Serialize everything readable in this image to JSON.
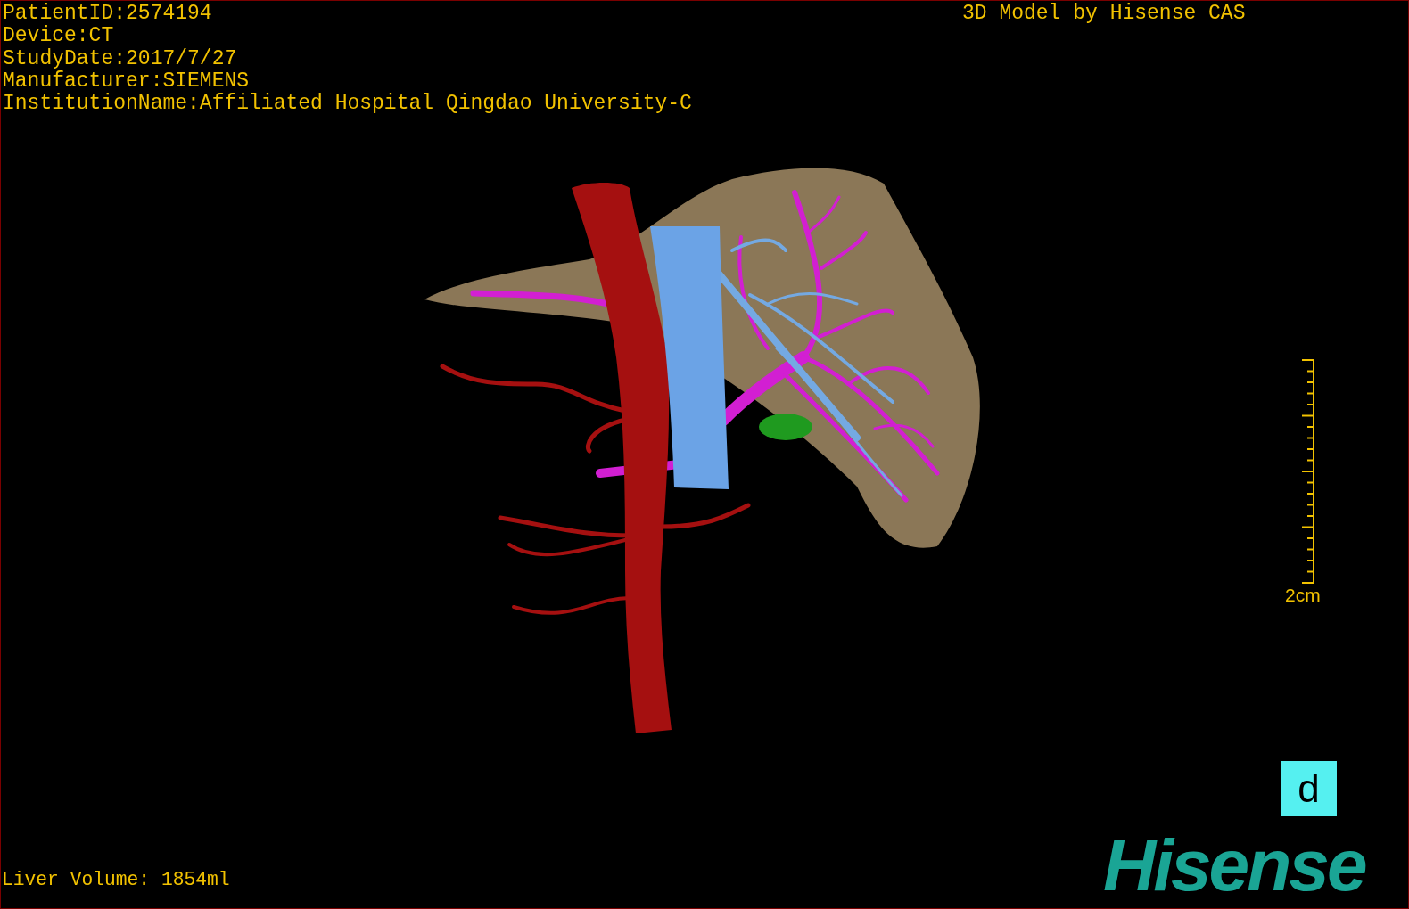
{
  "patient_info": [
    "PatientID:2574194",
    "Device:CT",
    "StudyDate:2017/7/27",
    "Manufacturer:SIEMENS",
    "InstitutionName:Affiliated Hospital Qingdao University-C"
  ],
  "credit": "3D Model by Hisense CAS",
  "scale": {
    "label": "2cm"
  },
  "orientation_marker": "d",
  "liver_volume": "Liver Volume: 1854ml",
  "logo": "Hisense"
}
